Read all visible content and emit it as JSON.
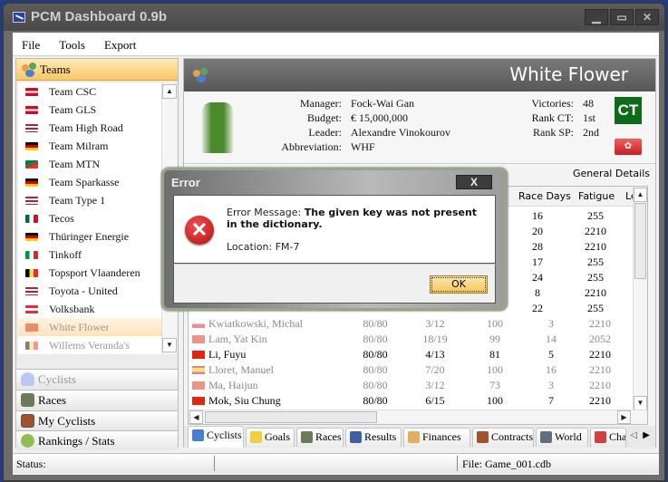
{
  "window": {
    "title": "PCM Dashboard 0.9b",
    "controls": {
      "minimize": "▁",
      "maximize": "▭",
      "close": "✕"
    }
  },
  "menu": [
    "File",
    "Tools",
    "Export"
  ],
  "sidebar": {
    "header": "Teams",
    "teams": [
      {
        "name": "Team CSC",
        "flag": "denmark"
      },
      {
        "name": "Team GLS",
        "flag": "denmark"
      },
      {
        "name": "Team High Road",
        "flag": "usa"
      },
      {
        "name": "Team Milram",
        "flag": "germany"
      },
      {
        "name": "Team MTN",
        "flag": "south-africa"
      },
      {
        "name": "Team Sparkasse",
        "flag": "germany"
      },
      {
        "name": "Team Type 1",
        "flag": "usa"
      },
      {
        "name": "Tecos",
        "flag": "mexico"
      },
      {
        "name": "Thüringer Energie",
        "flag": "germany"
      },
      {
        "name": "Tinkoff",
        "flag": "italy"
      },
      {
        "name": "Topsport Vlaanderen",
        "flag": "belgium"
      },
      {
        "name": "Toyota - United",
        "flag": "usa"
      },
      {
        "name": "Volksbank",
        "flag": "austria"
      },
      {
        "name": "White Flower",
        "flag": "hong-kong",
        "selected": true
      },
      {
        "name": "Willems Veranda's",
        "flag": "belgium"
      }
    ],
    "nav": [
      "Cyclists",
      "Races",
      "My Cyclists",
      "Rankings / Stats"
    ]
  },
  "team": {
    "name": "White Flower",
    "manager_label": "Manager:",
    "manager": "Fock-Wai Gan",
    "budget_label": "Budget:",
    "budget": "€ 15,000,000",
    "leader_label": "Leader:",
    "leader": "Alexandre Vinokourov",
    "abbr_label": "Abbreviation:",
    "abbr": "WHF",
    "victories_label": "Victories:",
    "victories": "48",
    "rank_ct_label": "Rank CT:",
    "rank_ct": "1st",
    "rank_sp_label": "Rank SP:",
    "rank_sp": "2nd",
    "ct_badge": "CT",
    "general_details": "General Details"
  },
  "grid": {
    "headers": {
      "race_days": "Race Days",
      "fatigue": "Fatigue",
      "le": "Le"
    },
    "top_rows": [
      {
        "race_days": "16",
        "fatigue": "255"
      },
      {
        "race_days": "20",
        "fatigue": "2210"
      },
      {
        "race_days": "28",
        "fatigue": "2210"
      },
      {
        "race_days": "17",
        "fatigue": "255"
      },
      {
        "race_days": "24",
        "fatigue": "255"
      },
      {
        "race_days": "8",
        "fatigue": "2210"
      },
      {
        "race_days": "22",
        "fatigue": "255"
      }
    ],
    "rows": [
      {
        "name": "Kwiatkowski, Michal",
        "c1": "80/80",
        "c2": "3/12",
        "c3": "100",
        "c4": "3",
        "c5": "2210",
        "dim": true,
        "flag": "poland"
      },
      {
        "name": "Lam, Yat Kin",
        "c1": "80/80",
        "c2": "18/19",
        "c3": "99",
        "c4": "14",
        "c5": "2052",
        "dim": true,
        "flag": "hong-kong"
      },
      {
        "name": "Li, Fuyu",
        "c1": "80/80",
        "c2": "4/13",
        "c3": "81",
        "c4": "5",
        "c5": "2210",
        "dim": false,
        "flag": "china"
      },
      {
        "name": "Lloret, Manuel",
        "c1": "80/80",
        "c2": "7/20",
        "c3": "100",
        "c4": "16",
        "c5": "2210",
        "dim": true,
        "flag": "spain"
      },
      {
        "name": "Ma, Haijun",
        "c1": "80/80",
        "c2": "3/12",
        "c3": "73",
        "c4": "3",
        "c5": "2210",
        "dim": true,
        "flag": "china"
      },
      {
        "name": "Mok, Siu Chung",
        "c1": "80/80",
        "c2": "6/15",
        "c3": "100",
        "c4": "7",
        "c5": "2210",
        "dim": false,
        "flag": "hong-kong"
      }
    ]
  },
  "tabs": [
    "Cyclists",
    "Goals",
    "Races",
    "Results",
    "Finances",
    "Contracts",
    "World",
    "Cha"
  ],
  "status": {
    "label": "Status:",
    "file": "File: Game_001.cdb"
  },
  "dialog": {
    "title": "Error",
    "close": "X",
    "message_label": "Error Message:",
    "message": "The given key was not present in the dictionary.",
    "location": "Location: FM-7",
    "ok": "OK"
  },
  "colors": {
    "accent": "#f8c866",
    "ct_badge": "#0d6b1a",
    "error_red": "#c81f25"
  }
}
